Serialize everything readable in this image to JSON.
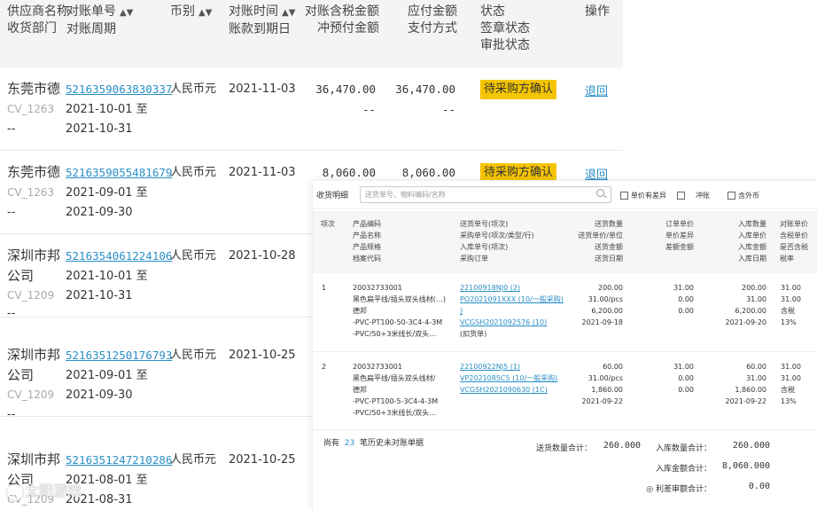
{
  "table": {
    "headers": {
      "supplier": "供应商名称",
      "dept": "收货部门",
      "recon_no": "对账单号",
      "period": "对账周期",
      "currency": "币别",
      "recon_time": "对账时间",
      "due_date": "账款到期日",
      "tax_amount": "对账含税金额",
      "prepay": "冲预付金额",
      "payable": "应付金额",
      "pay_method": "支付方式",
      "status": "状态",
      "sign_status": "签章状态",
      "approve_status": "审批状态",
      "action": "操作"
    },
    "rows": [
      {
        "supplier": "东莞市德邦",
        "code": "CV_1263",
        "dept": "--",
        "recon_no": "5216359063830337",
        "period_from": "2021-10-01 至",
        "period_to": "2021-10-31",
        "currency": "人民币元",
        "recon_time": "2021-11-03",
        "tax_amount": "36,470.00",
        "prepay": "--",
        "payable": "36,470.00",
        "pay_method": "--",
        "status": "待采购方确认",
        "action": "退回"
      },
      {
        "supplier": "东莞市德邦",
        "code": "CV_1263",
        "dept": "--",
        "recon_no": "5216359055481679",
        "period_from": "2021-09-01 至",
        "period_to": "2021-09-30",
        "currency": "人民币元",
        "recon_time": "2021-11-03",
        "tax_amount": "8,060.00",
        "prepay": "",
        "payable": "8,060.00",
        "pay_method": "",
        "status": "待采购方确认",
        "action": "退回"
      },
      {
        "supplier": "深圳市邦",
        "supplier2": "公司",
        "code": "CV_1209",
        "dept": "--",
        "recon_no": "5216354061224106",
        "period_from": "2021-10-01 至",
        "period_to": "2021-10-31",
        "currency": "人民币元",
        "recon_time": "2021-10-28"
      },
      {
        "supplier": "深圳市邦",
        "supplier2": "公司",
        "code": "CV_1209",
        "dept": "--",
        "recon_no": "5216351250176793",
        "period_from": "2021-09-01 至",
        "period_to": "2021-09-30",
        "currency": "人民币元",
        "recon_time": "2021-10-25"
      },
      {
        "supplier": "深圳市邦",
        "supplier2": "公司",
        "code": "CV_1209",
        "recon_no": "5216351247210286",
        "period_from": "2021-08-01 至",
        "period_to": "2021-08-31",
        "currency": "人民币元",
        "recon_time": "2021-10-25"
      }
    ]
  },
  "popover": {
    "title": "收货明细",
    "search_placeholder": "送货单号、物料编码/名称",
    "filters": [
      "单价有差异",
      "冲账",
      "含外币"
    ],
    "headers": {
      "no": "项次",
      "product": [
        "产品编码",
        "产品名称",
        "产品规格",
        "档案代码"
      ],
      "doc": [
        "送货单号(项次)",
        "采购单号(项次/类型/行)",
        "入库单号(项次)",
        "采购订单"
      ],
      "qty": [
        "送货数量",
        "送货单价/单位",
        "送货金额",
        "送货日期"
      ],
      "diff": [
        "订单单价",
        "单价差异",
        "差额金额"
      ],
      "inbound": [
        "入库数量",
        "入库单价",
        "入库金额",
        "入库日期"
      ],
      "recon": [
        "对账单价",
        "含税单价",
        "是否含税",
        "税率"
      ]
    },
    "items": [
      {
        "no": "1",
        "product": [
          "20032733001",
          "黑色扁平线/插头双头线材(…)",
          "德邦",
          "-PVC-PT100-50-3C4-4-3M",
          "-PVC/50+3米线长/双头…"
        ],
        "doc": [
          "22100918NJ0 (2)",
          "PO2021091XXX (10/一般采购)",
          ")",
          "VCGSH2021092576 (10)",
          "(扣货单)"
        ],
        "qty": [
          "200.00",
          "31.00/pcs",
          "6,200.00",
          "2021-09-18"
        ],
        "diff": [
          "31.00",
          "0.00",
          "0.00"
        ],
        "inbound": [
          "200.00",
          "31.00",
          "6,200.00",
          "2021-09-20"
        ],
        "recon": [
          "31.00",
          "31.00",
          "含税",
          "13%"
        ]
      },
      {
        "no": "2",
        "product": [
          "20032733001",
          "黑色扁平线/插头双头线材/",
          "德邦",
          "-PVC-PT100-5-3C4-4-3M",
          "-PVC/50+3米线长/双头…"
        ],
        "doc": [
          "22100922NJ5 (1)",
          "VP2021085C5 (10/一般采购)",
          "VCGSH2021090630 (1C)"
        ],
        "qty": [
          "60.00",
          "31.00/pcs",
          "1,860.00",
          "2021-09-22"
        ],
        "diff": [
          "31.00",
          "0.00",
          "0.00"
        ],
        "inbound": [
          "60.00",
          "31.00",
          "1,860.00",
          "2021-09-22"
        ],
        "recon": [
          "31.00",
          "31.00",
          "含税",
          "13%"
        ]
      }
    ],
    "footer": {
      "prefix": "尚有",
      "count": "23",
      "suffix": "笔历史未对账单据"
    },
    "totals": {
      "delivery_qty_label": "送货数量合计：",
      "delivery_qty": "260.000",
      "inbound_qty_label": "入库数量合计：",
      "inbound_qty": "260.000",
      "inbound_amt_label": "入库金额合计：",
      "inbound_amt": "8,060.000",
      "adjust_label": "利差审额合计：",
      "adjust": "0.00"
    }
  },
  "watermark": "太阳游戏",
  "colors": {
    "badge": "#f5c400",
    "link": "#2a8fc7",
    "header_bg": "#f3f4f6"
  }
}
